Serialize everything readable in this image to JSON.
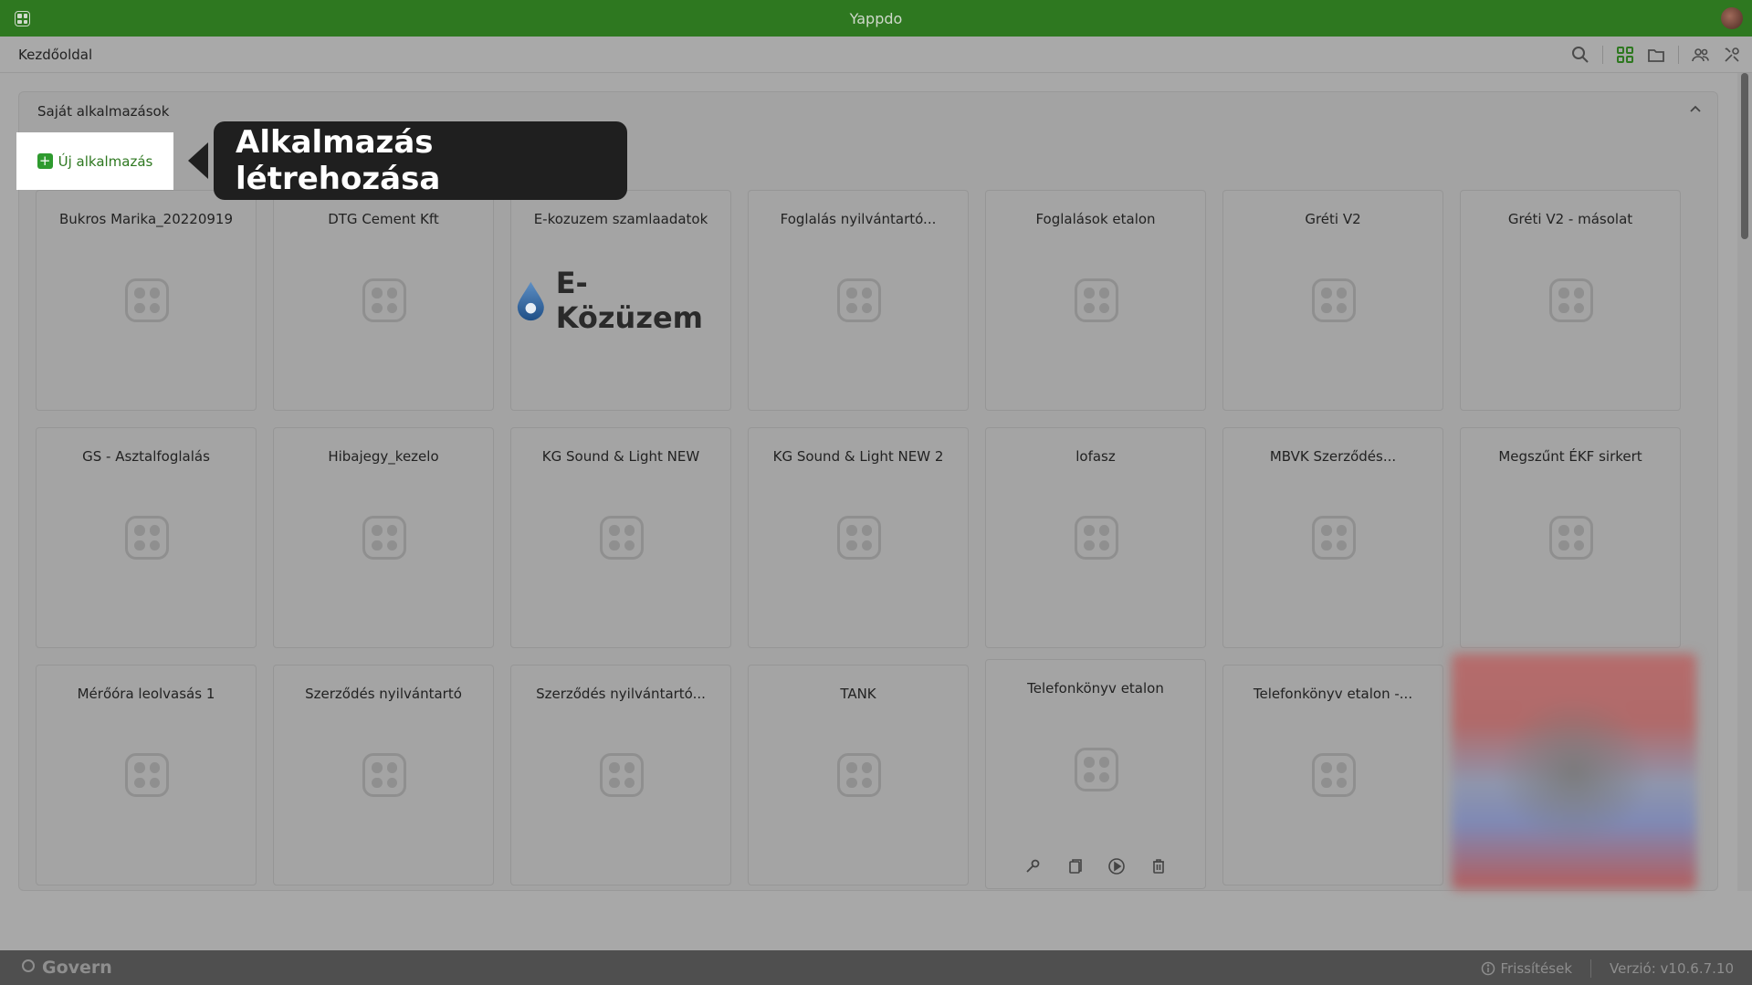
{
  "titlebar": {
    "title": "Yappdo"
  },
  "toolbar": {
    "breadcrumb": "Kezdőoldal"
  },
  "panel": {
    "title": "Saját alkalmazások"
  },
  "new_app": {
    "label": "Új alkalmazás",
    "plus": "+"
  },
  "tooltip": {
    "text": "Alkalmazás létrehozása"
  },
  "cards": [
    {
      "title": "Bukros Marika_20220919"
    },
    {
      "title": "DTG Cement Kft"
    },
    {
      "title": "E-kozuzem szamlaadatok",
      "logo_text": "E-Közüzem"
    },
    {
      "title": "Foglalás nyilvántartó..."
    },
    {
      "title": "Foglalások etalon"
    },
    {
      "title": "Gréti V2"
    },
    {
      "title": "Gréti V2 - másolat"
    },
    {
      "title": "GS - Asztalfoglalás"
    },
    {
      "title": "Hibajegy_kezelo"
    },
    {
      "title": "KG Sound & Light NEW"
    },
    {
      "title": "KG Sound & Light NEW 2"
    },
    {
      "title": "lofasz"
    },
    {
      "title": "MBVK Szerződés..."
    },
    {
      "title": "Megszűnt ÉKF sirkert"
    },
    {
      "title": "Mérőóra leolvasás 1"
    },
    {
      "title": "Szerződés nyilvántartó"
    },
    {
      "title": "Szerződés nyilvántartó..."
    },
    {
      "title": "TANK"
    },
    {
      "title": "Telefonkönyv etalon"
    },
    {
      "title": "Telefonkönyv etalon -..."
    }
  ],
  "footer": {
    "brand": "Govern",
    "updates": "Frissítések",
    "version": "Verzió: v10.6.7.10"
  },
  "colors": {
    "brand_green": "#2e7820",
    "tooltip_bg": "#1f1f1f"
  }
}
